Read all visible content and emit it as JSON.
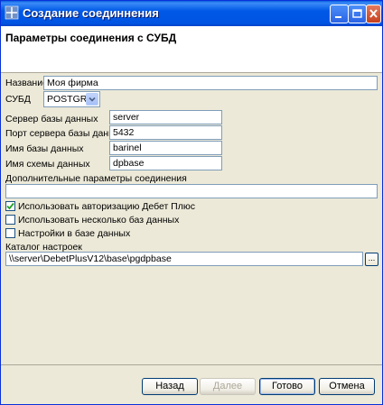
{
  "window": {
    "title": "Создание соединнения",
    "header_title": "Параметры соединения с СУБД"
  },
  "form": {
    "name_label": "Название",
    "name_value": "Моя фирма",
    "dbms_label": "СУБД",
    "dbms_value": "POSTGRE",
    "server_label": "Сервер базы данных",
    "server_value": "server",
    "port_label": "Порт сервера базы данных",
    "port_value": "5432",
    "dbname_label": "Имя базы данных",
    "dbname_value": "barinel",
    "schema_label": "Имя схемы данных",
    "schema_value": "dpbase",
    "extra_label": "Дополнительные параметры соединения",
    "extra_value": "",
    "cb_auth_label": "Использовать авторизацию Дебет Плюс",
    "cb_auth_checked": true,
    "cb_multi_label": "Использовать несколько баз данных",
    "cb_multi_checked": false,
    "cb_settings_label": "Настройки в базе данных",
    "cb_settings_checked": false,
    "catalog_label": "Каталог настроек",
    "catalog_value": "\\\\server\\DebetPlusV12\\base\\pgdpbase",
    "browse_label": "..."
  },
  "buttons": {
    "back": "Назад",
    "next": "Далее",
    "finish": "Готово",
    "cancel": "Отмена"
  },
  "colors": {
    "titlebar": "#0054e3",
    "dialog_bg": "#ece9d8",
    "field_border": "#7f9db9",
    "checkbox_check": "#21a121"
  }
}
